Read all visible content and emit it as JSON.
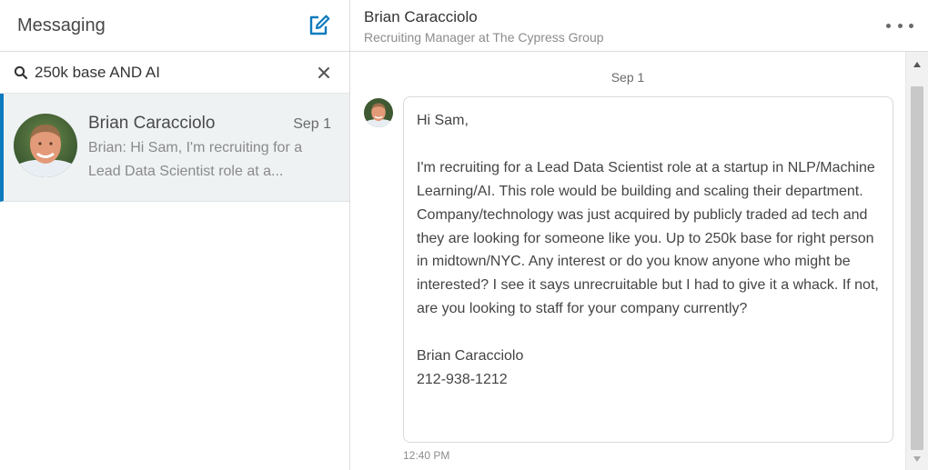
{
  "sidebar": {
    "title": "Messaging",
    "compose_icon": "compose-icon",
    "search": {
      "value": "250k base AND AI",
      "icon": "search-icon",
      "clear_icon": "close-icon"
    },
    "conversations": [
      {
        "name": "Brian Caracciolo",
        "date": "Sep 1",
        "snippet": "Brian: Hi Sam, I'm recruiting for a Lead Data Scientist role at a...",
        "selected": true
      }
    ]
  },
  "thread": {
    "contact_name": "Brian Caracciolo",
    "contact_headline": "Recruiting Manager at The Cypress Group",
    "more_icon": "more-options-icon",
    "date_separator": "Sep 1",
    "message": {
      "text": "Hi Sam,\n\nI'm recruiting for a Lead Data Scientist role at a startup in NLP/Machine Learning/AI. This role would be building and scaling their department. Company/technology was just acquired by publicly traded ad tech and they are looking for someone like you. Up to 250k base for right person in midtown/NYC. Any interest or do you know anyone who might be interested? I see it says unrecruitable but I had to give it a whack. If not, are you looking to staff for your company currently?\n\nBrian Caracciolo\n212-938-1212",
      "time": "12:40 PM"
    }
  },
  "colors": {
    "accent": "#0d7bbd",
    "selected_bg": "#eef2f3",
    "border": "#dcdcdc"
  }
}
